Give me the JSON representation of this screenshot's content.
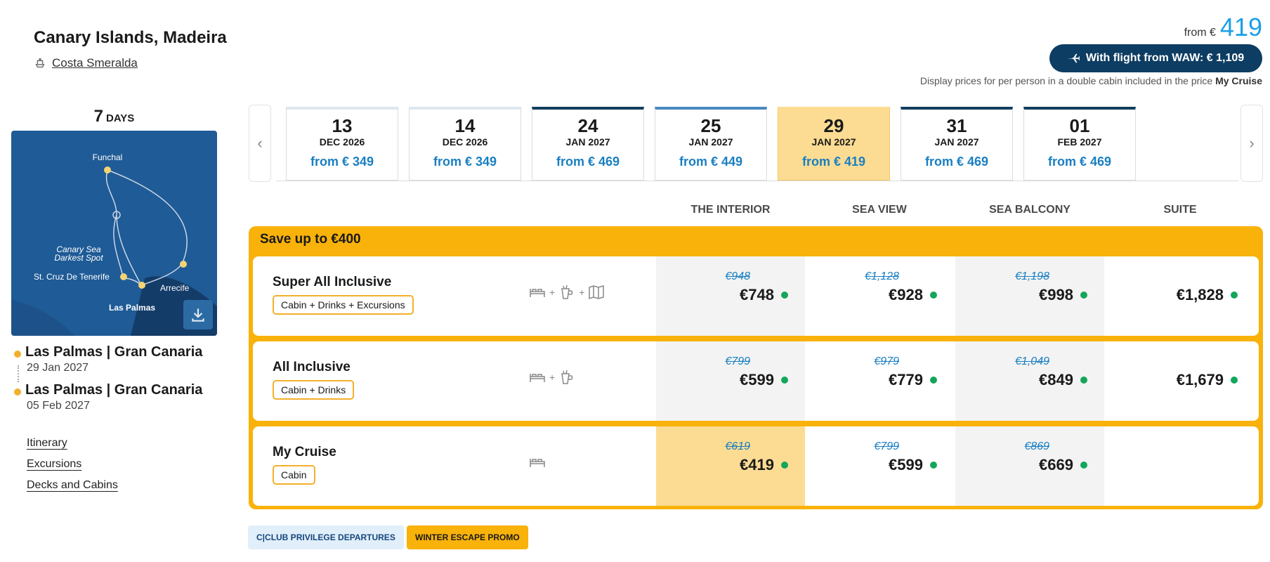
{
  "header": {
    "title": "Canary Islands, Madeira",
    "ship": "Costa Smeralda",
    "from_label": "from €",
    "price": "419",
    "flight_button": "With flight from WAW: € 1,109",
    "disclaimer_prefix": "Display prices for per person in a double cabin included in the price",
    "disclaimer_bold": "My Cruise"
  },
  "sidebar": {
    "days_number": "7",
    "days_label": "DAYS",
    "map_labels": {
      "funchal": "Funchal",
      "canary_sea_1": "Canary Sea",
      "canary_sea_2": "Darkest Spot",
      "tenerife": "St. Cruz De Tenerife",
      "arrecife": "Arrecife",
      "las_palmas": "Las Palmas"
    },
    "departure": {
      "port": "Las Palmas | Gran Canaria",
      "date": "29 Jan 2027"
    },
    "arrival": {
      "port": "Las Palmas | Gran Canaria",
      "date": "05 Feb 2027"
    },
    "links": [
      "Itinerary",
      "Excursions",
      "Decks and Cabins"
    ]
  },
  "dates": [
    {
      "day": "13",
      "month": "DEC 2026",
      "price": "from € 349",
      "top": "light"
    },
    {
      "day": "14",
      "month": "DEC 2026",
      "price": "from € 349",
      "top": "light"
    },
    {
      "day": "24",
      "month": "JAN 2027",
      "price": "from € 469",
      "top": "dark"
    },
    {
      "day": "25",
      "month": "JAN 2027",
      "price": "from € 449",
      "top": "mid"
    },
    {
      "day": "29",
      "month": "JAN 2027",
      "price": "from € 419",
      "top": "selected"
    },
    {
      "day": "31",
      "month": "JAN 2027",
      "price": "from € 469",
      "top": "dark"
    },
    {
      "day": "01",
      "month": "FEB 2027",
      "price": "from € 469",
      "top": "dark"
    }
  ],
  "nav": {
    "prev": "‹",
    "next": "›"
  },
  "columns": [
    "THE INTERIOR",
    "SEA VIEW",
    "SEA BALCONY",
    "SUITE"
  ],
  "offer_banner": "Save up to €400",
  "packages": [
    {
      "name": "Super All Inclusive",
      "tag": "Cabin + Drinks + Excursions",
      "icons": [
        "bed-icon",
        "drink-icon",
        "map-icon"
      ],
      "prices": [
        {
          "old": "€948",
          "new": "€748"
        },
        {
          "old": "€1,128",
          "new": "€928"
        },
        {
          "old": "€1,198",
          "new": "€998"
        },
        {
          "old": "",
          "new": "€1,828"
        }
      ]
    },
    {
      "name": "All Inclusive",
      "tag": "Cabin + Drinks",
      "icons": [
        "bed-icon",
        "drink-icon"
      ],
      "prices": [
        {
          "old": "€799",
          "new": "€599"
        },
        {
          "old": "€979",
          "new": "€779"
        },
        {
          "old": "€1,049",
          "new": "€849"
        },
        {
          "old": "",
          "new": "€1,679"
        }
      ]
    },
    {
      "name": "My Cruise",
      "tag": "Cabin",
      "icons": [
        "bed-icon"
      ],
      "prices": [
        {
          "old": "€619",
          "new": "€419"
        },
        {
          "old": "€799",
          "new": "€599"
        },
        {
          "old": "€869",
          "new": "€669"
        },
        {
          "old": "",
          "new": ""
        }
      ]
    }
  ],
  "badges": [
    "C|CLUB PRIVILEGE DEPARTURES",
    "WINTER ESCAPE PROMO"
  ],
  "colors": {
    "accent": "#1aa0e6",
    "navy": "#0d3d63",
    "promo": "#f8b20a",
    "selected": "#fcdc92",
    "available": "#13a65a"
  }
}
